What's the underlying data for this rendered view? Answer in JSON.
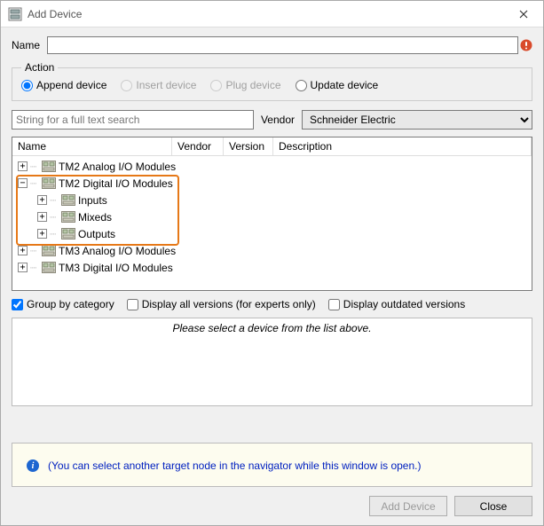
{
  "window": {
    "title": "Add Device"
  },
  "name_field": {
    "label": "Name",
    "value": ""
  },
  "action": {
    "legend": "Action",
    "options": {
      "append": "Append device",
      "insert": "Insert device",
      "plug": "Plug device",
      "update": "Update device"
    },
    "selected": "append",
    "disabled": [
      "insert",
      "plug"
    ]
  },
  "search": {
    "placeholder": "String for a full text search",
    "vendor_label": "Vendor",
    "vendor_value": "Schneider Electric"
  },
  "tree": {
    "columns": {
      "name": "Name",
      "vendor": "Vendor",
      "version": "Version",
      "description": "Description"
    },
    "nodes": [
      {
        "label": "TM2 Analog I/O Modules",
        "expanded": false,
        "level": 0
      },
      {
        "label": "TM2 Digital I/O Modules",
        "expanded": true,
        "level": 0,
        "children": [
          {
            "label": "Inputs",
            "expanded": false,
            "level": 1
          },
          {
            "label": "Mixeds",
            "expanded": false,
            "level": 1
          },
          {
            "label": "Outputs",
            "expanded": false,
            "level": 1
          }
        ]
      },
      {
        "label": "TM3 Analog I/O Modules",
        "expanded": false,
        "level": 0
      },
      {
        "label": "TM3 Digital I/O Modules",
        "expanded": false,
        "level": 0
      }
    ]
  },
  "options": {
    "group_by_category": {
      "label": "Group by category",
      "checked": true
    },
    "display_all_versions": {
      "label": "Display all versions (for experts only)",
      "checked": false
    },
    "display_outdated": {
      "label": "Display outdated versions",
      "checked": false
    }
  },
  "info_panel": {
    "text": "Please select a device from the list above."
  },
  "hint_panel": {
    "text": "(You can select another target node in the navigator while this window is open.)"
  },
  "buttons": {
    "add": "Add Device",
    "close": "Close"
  }
}
